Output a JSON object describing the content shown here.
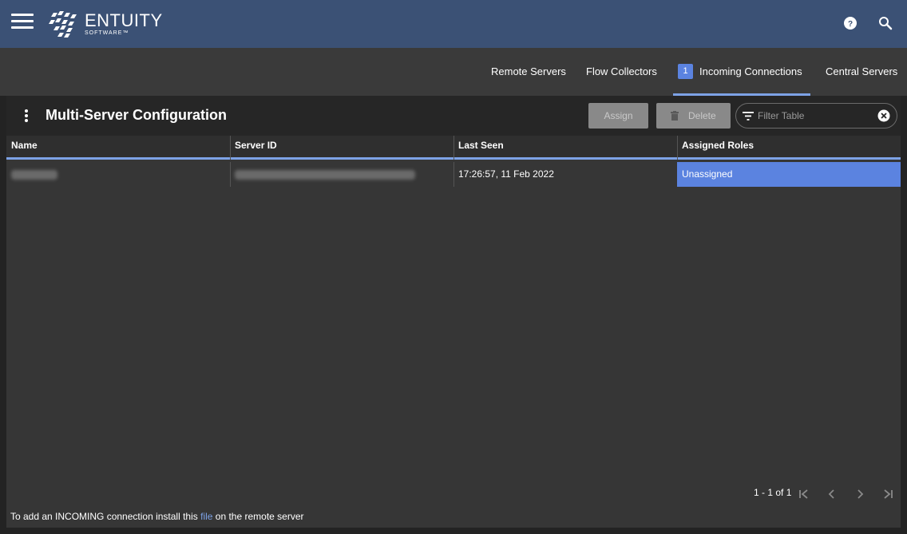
{
  "app": {
    "logo_main": "ENTUITY",
    "logo_sub": "SOFTWARE™"
  },
  "icons": {
    "menu": "hamburger-menu-icon",
    "logo": "entuity-logo-icon",
    "help": "help-icon",
    "search": "search-icon",
    "kebab": "more-vertical-icon",
    "trash": "trash-icon",
    "filter": "filter-icon",
    "clear": "clear-circle-icon",
    "first": "first-page-icon",
    "prev": "chevron-left-icon",
    "next": "chevron-right-icon",
    "last": "last-page-icon"
  },
  "tabs": [
    {
      "label": "Remote Servers"
    },
    {
      "label": "Flow Collectors"
    },
    {
      "label": "Incoming Connections",
      "badge": "1",
      "active": true
    },
    {
      "label": "Central Servers"
    }
  ],
  "panel": {
    "title": "Multi-Server Configuration",
    "assign_label": "Assign",
    "delete_label": "Delete",
    "filter_placeholder": "Filter Table"
  },
  "table": {
    "columns": [
      "Name",
      "Server ID",
      "Last Seen",
      "Assigned Roles"
    ],
    "rows": [
      {
        "name": "",
        "server_id": "",
        "last_seen": "17:26:57, 11 Feb 2022",
        "assigned_roles": "Unassigned"
      }
    ]
  },
  "pagination": {
    "range": "1 - 1 of 1"
  },
  "footer": {
    "prefix": "To add an INCOMING connection install this ",
    "link": "file",
    "suffix": " on the remote server"
  },
  "colors": {
    "header": "#3b5175",
    "accent": "#7da2e6",
    "selected_cell": "#5b83e0"
  }
}
